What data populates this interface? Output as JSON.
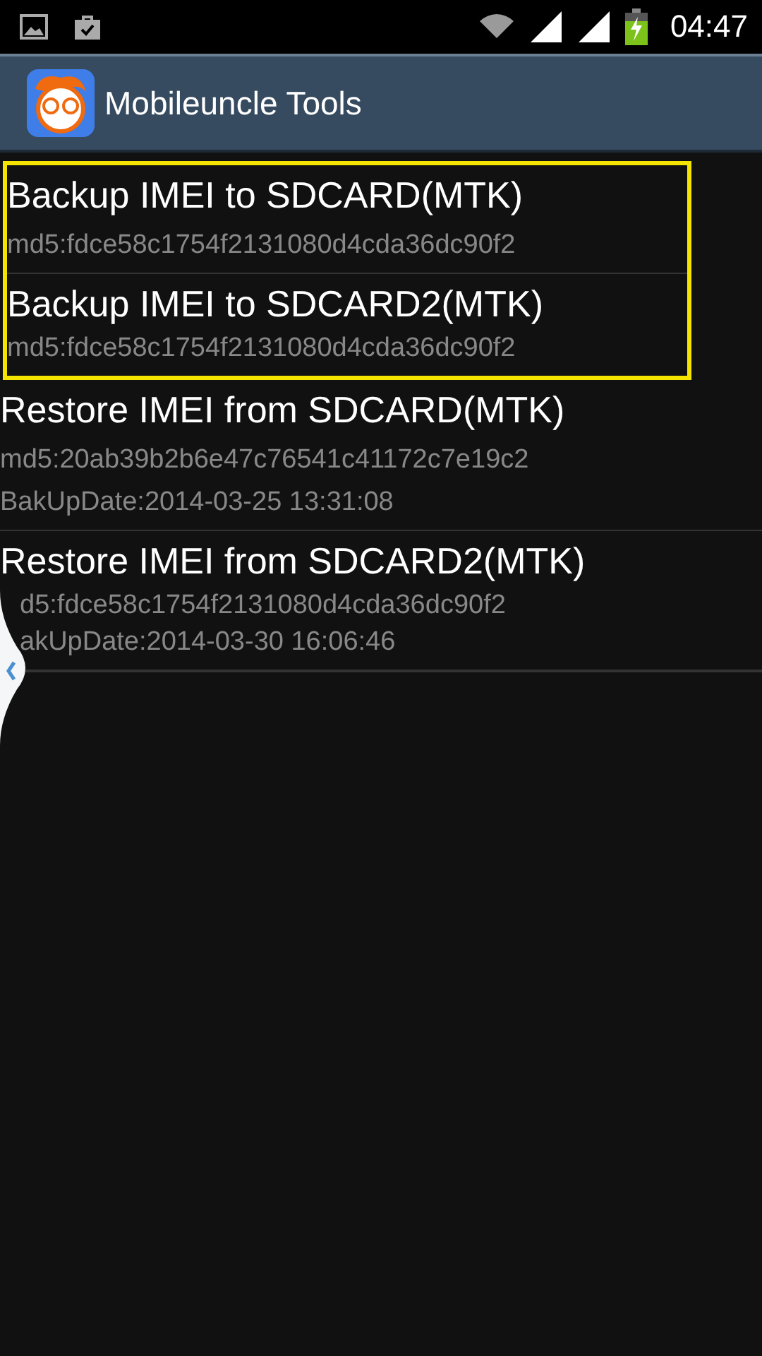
{
  "status_bar": {
    "time": "04:47"
  },
  "action_bar": {
    "title": "Mobileuncle Tools"
  },
  "items": [
    {
      "title": "Backup IMEI to SDCARD(MTK)",
      "details": [
        "md5:fdce58c1754f2131080d4cda36dc90f2"
      ],
      "highlighted": true,
      "covered": false
    },
    {
      "title": "Backup IMEI to SDCARD2(MTK)",
      "details": [
        "md5:fdce58c1754f2131080d4cda36dc90f2"
      ],
      "highlighted": true,
      "covered": false
    },
    {
      "title": "Restore IMEI from SDCARD(MTK)",
      "details": [
        "md5:20ab39b2b6e47c76541c41172c7e19c2",
        "BakUpDate:2014-03-25 13:31:08"
      ],
      "highlighted": false,
      "covered": false
    },
    {
      "title": "Restore IMEI from SDCARD2(MTK)",
      "details": [
        "d5:fdce58c1754f2131080d4cda36dc90f2",
        "akUpDate:2014-03-30 16:06:46"
      ],
      "highlighted": false,
      "covered": true
    }
  ]
}
